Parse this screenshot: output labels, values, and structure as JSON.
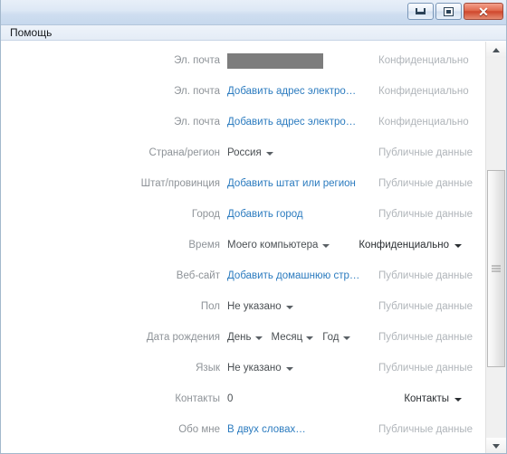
{
  "window": {
    "title": "",
    "buttons": {
      "minimize": "minimize",
      "maximize": "maximize",
      "close": "✕"
    }
  },
  "menubar": {
    "items": [
      {
        "label": "Помощь"
      }
    ]
  },
  "profile": {
    "rows": [
      {
        "label": "Эл. почта",
        "value": "",
        "value_type": "redacted",
        "privacy": "Конфиденциально",
        "privacy_strong": false
      },
      {
        "label": "Эл. почта",
        "value": "Добавить адрес электро…",
        "value_type": "link",
        "privacy": "Конфиденциально",
        "privacy_strong": false
      },
      {
        "label": "Эл. почта",
        "value": "Добавить адрес электро…",
        "value_type": "link",
        "privacy": "Конфиденциально",
        "privacy_strong": false
      },
      {
        "label": "Страна/регион",
        "value": "Россия",
        "value_type": "dropdown",
        "privacy": "Публичные данные",
        "privacy_strong": false
      },
      {
        "label": "Штат/провинция",
        "value": "Добавить штат или регион",
        "value_type": "link",
        "privacy": "Публичные данные",
        "privacy_strong": false
      },
      {
        "label": "Город",
        "value": "Добавить город",
        "value_type": "link",
        "privacy": "Публичные данные",
        "privacy_strong": false
      },
      {
        "label": "Время",
        "value": "Моего компьютера",
        "value_type": "dropdown",
        "privacy": "Конфиденциально",
        "privacy_strong": true
      },
      {
        "label": "Веб-сайт",
        "value": "Добавить домашнюю стр…",
        "value_type": "link",
        "privacy": "Публичные данные",
        "privacy_strong": false
      },
      {
        "label": "Пол",
        "value": "Не указано",
        "value_type": "dropdown",
        "privacy": "Публичные данные",
        "privacy_strong": false
      },
      {
        "label": "Дата рождения",
        "value": "",
        "value_type": "dob",
        "dob": [
          "День",
          "Месяц",
          "Год"
        ],
        "privacy": "Публичные данные",
        "privacy_strong": false
      },
      {
        "label": "Язык",
        "value": "Не указано",
        "value_type": "dropdown",
        "privacy": "Публичные данные",
        "privacy_strong": false
      },
      {
        "label": "Контакты",
        "value": "0",
        "value_type": "plain",
        "privacy": "Контакты",
        "privacy_strong": true
      },
      {
        "label": "Обо мне",
        "value": "В двух словах…",
        "value_type": "link",
        "privacy": "Публичные данные",
        "privacy_strong": false
      }
    ]
  },
  "scrollbar": {
    "up_arrow": "scroll-up",
    "down_arrow": "scroll-down",
    "thumb": "scroll-thumb"
  },
  "colors": {
    "link": "#2b7bbf",
    "label": "#8e9398",
    "privacy_muted": "#b0b5ba",
    "privacy_strong": "#2a2e32",
    "redacted": "#7d7d7d",
    "titlebar_top": "#e8eff8",
    "close_button": "#cf472c"
  }
}
